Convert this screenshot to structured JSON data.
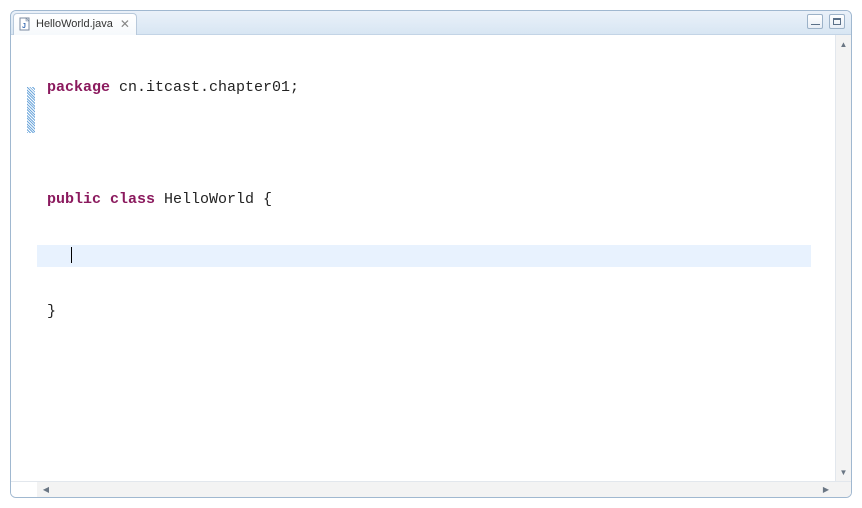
{
  "tab": {
    "filename": "HelloWorld.java",
    "closeGlyph": "✕"
  },
  "code": {
    "line1_kw": "package",
    "line1_rest": " cn.itcast.chapter01;",
    "line2": "",
    "line3_kw1": "public",
    "line3_kw2": " class",
    "line3_rest": " HelloWorld {",
    "line4": "",
    "line5": "}"
  },
  "scroll": {
    "up": "▲",
    "down": "▼",
    "left": "◀",
    "right": "▶"
  }
}
